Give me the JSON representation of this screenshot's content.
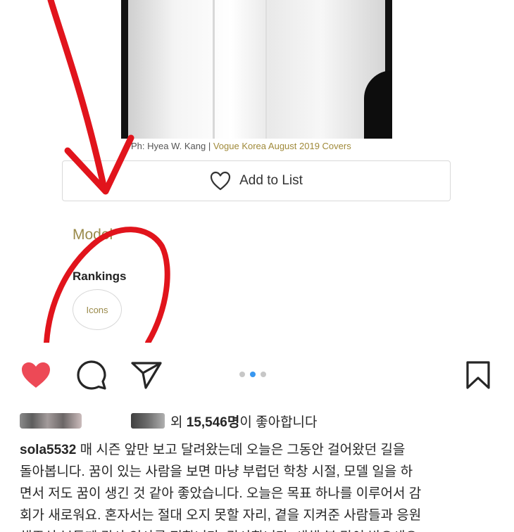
{
  "embed": {
    "photo_caption_credit": "Ph: Hyea W. Kang",
    "photo_caption_sep": " | ",
    "photo_caption_link": "Vogue Korea August 2019 Covers",
    "add_to_list_label": "Add to List",
    "section_model": "Model",
    "rankings_heading": "Rankings",
    "rankings_badge": "Icons"
  },
  "post": {
    "carousel": {
      "count": 3,
      "active_index": 1
    },
    "likes": {
      "prefix": "외 ",
      "count": "15,546명",
      "suffix": "이 좋아합니다"
    },
    "caption": {
      "username": "sola5532",
      "lines": [
        " 매 시즌 앞만 보고 달려왔는데 오늘은 그동안 걸어왔던 길을",
        "돌아봅니다. 꿈이 있는 사람을 보면 마냥 부럽던 학창 시절, 모델 일을 하",
        "면서 저도 꿈이 생긴 것 같아 좋았습니다. 오늘은 목표 하나를 이루어서 감",
        "회가 새로워요. 혼자서는 절대 오지 못할 자리, 곁을 지켜준 사람들과 응원",
        "해주신 분들께 감사 인사를 전합니다. 감사합니다. 새해 복 많이 받으세요"
      ]
    }
  },
  "icons": {
    "heart_like": "heart-filled-icon",
    "comment": "comment-icon",
    "share": "paper-plane-icon",
    "save": "bookmark-icon",
    "add_list_heart": "heart-outline-icon"
  },
  "colors": {
    "like_red": "#ed4956",
    "carousel_active": "#3897f0",
    "annotation_red": "#e1141c",
    "gold_text": "#9a8a4a"
  }
}
